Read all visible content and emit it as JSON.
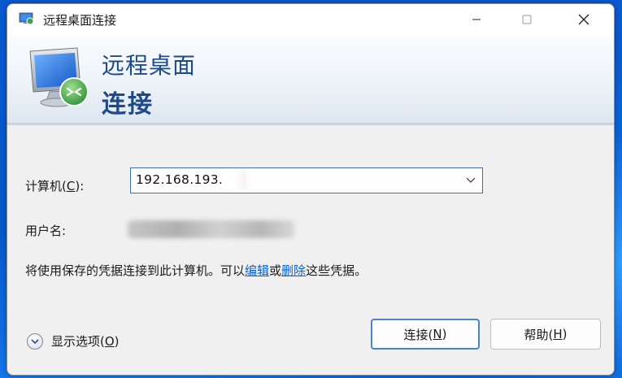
{
  "window": {
    "title": "远程桌面连接"
  },
  "banner": {
    "line1": "远程桌面",
    "line2": "连接"
  },
  "form": {
    "computer_label_prefix": "计算机(",
    "computer_label_key": "C",
    "computer_label_suffix": "):",
    "computer_value": "192.168.193.",
    "user_label": "用户名:"
  },
  "info": {
    "text_before": "将使用保存的凭据连接到此计算机。可以",
    "edit_link": "编辑",
    "middle": "或",
    "delete_link": "删除",
    "text_after": "这些凭据。"
  },
  "options": {
    "label_prefix": "显示选项(",
    "label_key": "O",
    "label_suffix": ")"
  },
  "buttons": {
    "connect_prefix": "连接(",
    "connect_key": "N",
    "connect_suffix": ")",
    "help_prefix": "帮助(",
    "help_key": "H",
    "help_suffix": ")"
  },
  "icons": {
    "app": "remote-desktop-icon",
    "minimize": "minimize-icon",
    "maximize": "maximize-icon",
    "close": "close-icon",
    "dropdown": "chevron-down-icon",
    "options": "expand-circle-icon"
  },
  "colors": {
    "banner_text": "#1f4a8a",
    "link": "#0b63c9",
    "focus_border": "#4a84c6"
  }
}
